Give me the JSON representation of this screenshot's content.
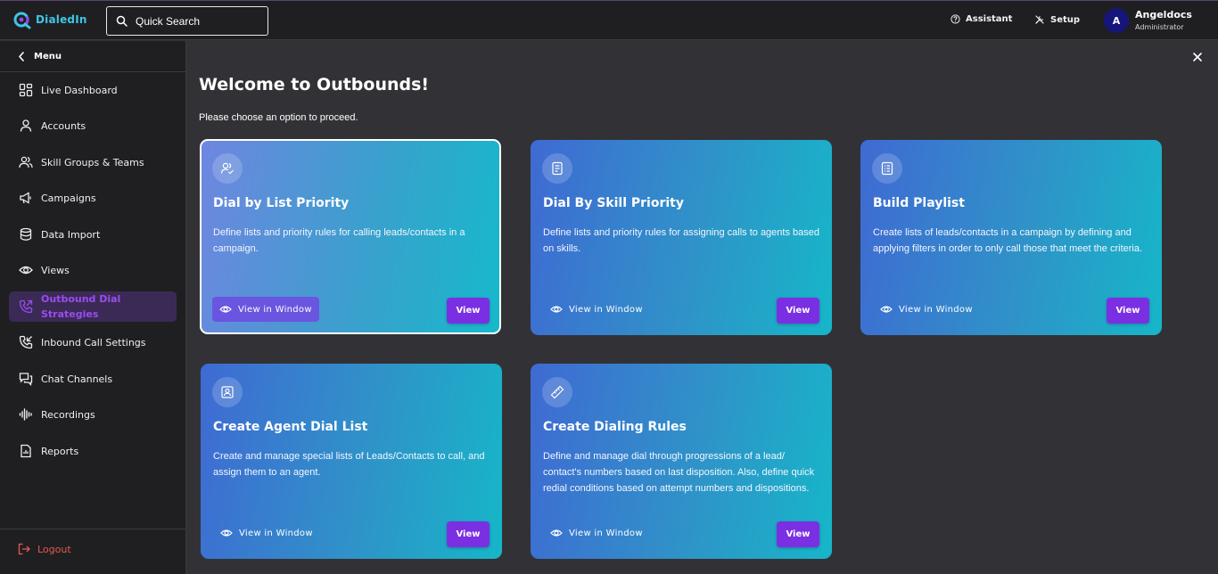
{
  "app": {
    "logo_text": "DialedIn"
  },
  "header": {
    "search_label": "Quick Search",
    "assistant_label": "Assistant",
    "setup_label": "Setup",
    "avatar_initial": "A",
    "user_name": "Angeldocs",
    "user_role": "Administrator"
  },
  "sidebar": {
    "menu_label": "Menu",
    "items": [
      {
        "label": "Live Dashboard",
        "icon": "dashboard-icon"
      },
      {
        "label": "Accounts",
        "icon": "user-icon"
      },
      {
        "label": "Skill Groups & Teams",
        "icon": "users-icon"
      },
      {
        "label": "Campaigns",
        "icon": "megaphone-icon"
      },
      {
        "label": "Data Import",
        "icon": "database-icon"
      },
      {
        "label": "Views",
        "icon": "eye-icon"
      },
      {
        "label": "Outbound Dial Strategies",
        "icon": "phone-outgoing-icon",
        "active": true
      },
      {
        "label": "Inbound Call Settings",
        "icon": "phone-incoming-icon"
      },
      {
        "label": "Chat Channels",
        "icon": "chat-icon"
      },
      {
        "label": "Recordings",
        "icon": "waveform-icon"
      },
      {
        "label": "Reports",
        "icon": "report-icon"
      }
    ],
    "logout_label": "Logout"
  },
  "main": {
    "title": "Welcome to Outbounds!",
    "subtitle": "Please choose an option to proceed.",
    "view_in_window_label": "View in Window",
    "view_label": "View",
    "cards": [
      {
        "title": "Dial by List Priority",
        "description": "Define lists and priority rules for calling leads/contacts in a campaign.",
        "icon": "user-check-icon",
        "selected": true
      },
      {
        "title": "Dial By Skill Priority",
        "description": "Define lists and priority rules for assigning calls to agents based on skills.",
        "icon": "document-icon"
      },
      {
        "title": "Build Playlist",
        "description": "Create lists of leads/contacts in a campaign by defining and applying filters in order to only call those that meet the criteria.",
        "icon": "list-icon"
      },
      {
        "title": "Create Agent Dial List",
        "description": "Create and manage special lists of Leads/Contacts to call, and assign them to an agent.",
        "icon": "contact-card-icon"
      },
      {
        "title": "Create Dialing Rules",
        "description": "Define and manage dial through progressions of a lead/ contact's numbers based on last disposition. Also, define quick redial conditions based on attempt numbers and dispositions.",
        "icon": "ruler-icon"
      }
    ]
  },
  "colors": {
    "accent": "#7b2fe3",
    "active_nav_text": "#9a4cf0",
    "logout": "#e35a4d",
    "brand": "#3ec6e6"
  }
}
